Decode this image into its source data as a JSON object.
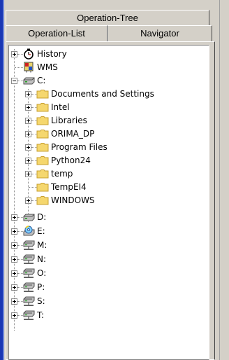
{
  "tabs": {
    "operation_tree": "Operation-Tree",
    "operation_list": "Operation-List",
    "navigator": "Navigator"
  },
  "tree": {
    "roots": [
      {
        "label": "History",
        "icon": "stopwatch-icon",
        "expander": "plus"
      },
      {
        "label": "WMS",
        "icon": "wms-map-icon",
        "expander": "none"
      },
      {
        "label": "C:",
        "icon": "hard-drive-icon",
        "expander": "minus"
      }
    ],
    "c_children": [
      {
        "label": "Documents and Settings",
        "expander": "plus"
      },
      {
        "label": "Intel",
        "expander": "plus"
      },
      {
        "label": "Libraries",
        "expander": "plus"
      },
      {
        "label": "ORIMA_DP",
        "expander": "plus"
      },
      {
        "label": "Program Files",
        "expander": "plus"
      },
      {
        "label": "Python24",
        "expander": "plus"
      },
      {
        "label": "temp",
        "expander": "plus"
      },
      {
        "label": "TempEI4",
        "expander": "none"
      },
      {
        "label": "WINDOWS",
        "expander": "plus"
      }
    ],
    "drives": [
      {
        "label": "D:",
        "icon": "hard-drive-icon"
      },
      {
        "label": "E:",
        "icon": "cd-drive-icon"
      },
      {
        "label": "M:",
        "icon": "network-drive-icon"
      },
      {
        "label": "N:",
        "icon": "network-drive-icon"
      },
      {
        "label": "O:",
        "icon": "network-drive-icon"
      },
      {
        "label": "P:",
        "icon": "network-drive-icon"
      },
      {
        "label": "S:",
        "icon": "network-drive-icon"
      },
      {
        "label": "T:",
        "icon": "network-drive-icon"
      }
    ]
  },
  "colors": {
    "folder": "#f5d76e",
    "folder_dark": "#c8a030",
    "accent_blue": "#1a37b4"
  }
}
